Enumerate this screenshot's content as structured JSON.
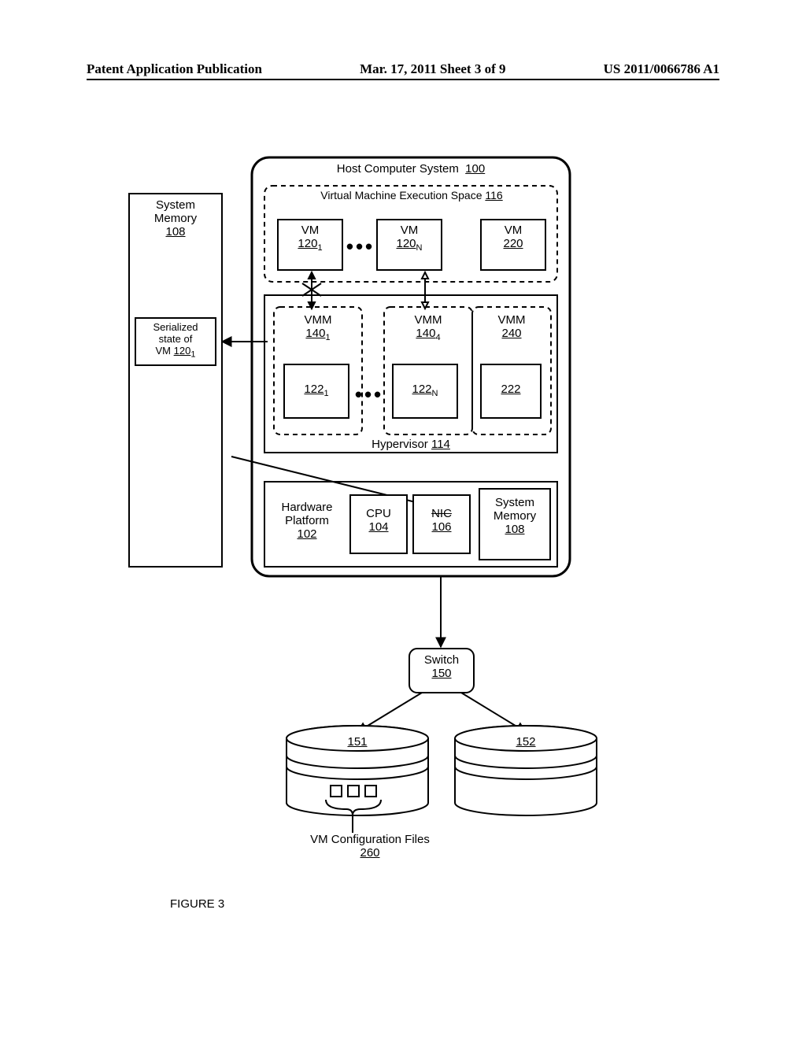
{
  "header": {
    "left": "Patent Application Publication",
    "center": "Mar. 17, 2011  Sheet 3 of 9",
    "right": "US 2011/0066786 A1"
  },
  "memory": {
    "title_line1": "System",
    "title_line2": "Memory",
    "ref": "108",
    "serialized_line1": "Serialized",
    "serialized_line2": "state of",
    "serialized_line3_prefix": "VM ",
    "serialized_ref": "120",
    "serialized_sub": "1"
  },
  "host": {
    "title": "Host Computer System",
    "ref": "100",
    "vmes_title": "Virtual Machine Execution Space",
    "vmes_ref": "116",
    "vm_label": "VM",
    "vm1_ref": "120",
    "vm1_sub": "1",
    "vmN_ref": "120",
    "vmN_sub": "N",
    "vm3_ref": "220",
    "vmm_label": "VMM",
    "vmm1_ref": "140",
    "vmm1_sub": "1",
    "vmm2_ref": "140",
    "vmm2_sub": "4",
    "vmm3_ref": "240",
    "dev1_ref": "122",
    "dev1_sub": "1",
    "dev2_ref": "122",
    "dev2_sub": "N",
    "dev3_ref": "222",
    "hyp_label": "Hypervisor",
    "hyp_ref": "114",
    "hw_line1": "Hardware",
    "hw_line2": "Platform",
    "hw_ref": "102",
    "cpu_label": "CPU",
    "cpu_ref": "104",
    "nic_label": "NIC",
    "nic_ref": "106",
    "smem_line1": "System",
    "smem_line2": "Memory",
    "smem_ref": "108",
    "ellipsis": "•••"
  },
  "switch": {
    "label": "Switch",
    "ref": "150"
  },
  "disk1": {
    "ref": "151"
  },
  "disk2": {
    "ref": "152"
  },
  "vcf": {
    "label": "VM Configuration Files",
    "ref": "260"
  },
  "figure": "FIGURE 3"
}
